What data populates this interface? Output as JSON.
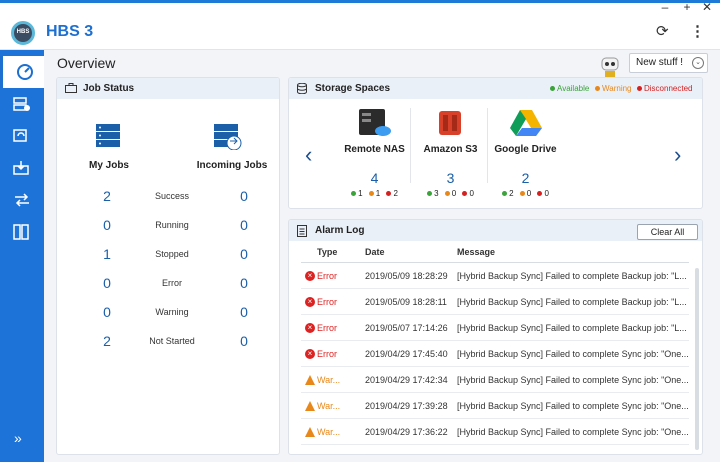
{
  "window": {
    "minimize": "–",
    "maximize": "+",
    "close": "✕"
  },
  "app": {
    "title": "HBS 3",
    "logo_text": "HBS"
  },
  "header": {
    "refresh_icon": "refresh-icon",
    "more_icon": "more-vert-icon"
  },
  "sidebar": {
    "items": [
      {
        "icon": "dashboard-icon",
        "active": true
      },
      {
        "icon": "backup-icon"
      },
      {
        "icon": "sync-icon"
      },
      {
        "icon": "restore-icon"
      },
      {
        "icon": "sync-jobs-icon"
      },
      {
        "icon": "services-icon"
      }
    ],
    "expand": "»"
  },
  "page": {
    "title": "Overview",
    "new_stuff": "New stuff !"
  },
  "job_status": {
    "title": "Job Status",
    "my_jobs": "My Jobs",
    "incoming_jobs": "Incoming Jobs",
    "rows": [
      {
        "label": "Success",
        "mine": "2",
        "incoming": "0"
      },
      {
        "label": "Running",
        "mine": "0",
        "incoming": "0"
      },
      {
        "label": "Stopped",
        "mine": "1",
        "incoming": "0"
      },
      {
        "label": "Error",
        "mine": "0",
        "incoming": "0"
      },
      {
        "label": "Warning",
        "mine": "0",
        "incoming": "0"
      },
      {
        "label": "Not Started",
        "mine": "2",
        "incoming": "0"
      }
    ]
  },
  "storage": {
    "title": "Storage Spaces",
    "legend": {
      "available": "Available",
      "warning": "Warning",
      "disconnected": "Disconnected"
    },
    "colors": {
      "available": "#3aa33a",
      "warning": "#e8881a",
      "disconnected": "#d62020"
    },
    "items": [
      {
        "name": "Remote NAS",
        "count": "4",
        "available": "1",
        "warning": "1",
        "disconnected": "2"
      },
      {
        "name": "Amazon S3",
        "count": "3",
        "available": "3",
        "warning": "0",
        "disconnected": "0"
      },
      {
        "name": "Google Drive",
        "count": "2",
        "available": "2",
        "warning": "0",
        "disconnected": "0"
      }
    ]
  },
  "alarm": {
    "title": "Alarm Log",
    "clear": "Clear All",
    "columns": {
      "type": "Type",
      "date": "Date",
      "message": "Message"
    },
    "rows": [
      {
        "type": "Error",
        "date": "2019/05/09 18:28:29",
        "message": "[Hybrid Backup Sync] Failed to complete Backup job: \"L..."
      },
      {
        "type": "Error",
        "date": "2019/05/09 18:28:11",
        "message": "[Hybrid Backup Sync] Failed to complete Backup job: \"L..."
      },
      {
        "type": "Error",
        "date": "2019/05/07 17:14:26",
        "message": "[Hybrid Backup Sync] Failed to complete Backup job: \"L..."
      },
      {
        "type": "Error",
        "date": "2019/04/29 17:45:40",
        "message": "[Hybrid Backup Sync] Failed to complete Sync job: \"One..."
      },
      {
        "type": "War...",
        "date": "2019/04/29 17:42:34",
        "message": "[Hybrid Backup Sync] Failed to complete Sync job: \"One..."
      },
      {
        "type": "War...",
        "date": "2019/04/29 17:39:28",
        "message": "[Hybrid Backup Sync] Failed to complete Sync job: \"One..."
      },
      {
        "type": "War...",
        "date": "2019/04/29 17:36:22",
        "message": "[Hybrid Backup Sync] Failed to complete Sync job: \"One..."
      }
    ]
  }
}
